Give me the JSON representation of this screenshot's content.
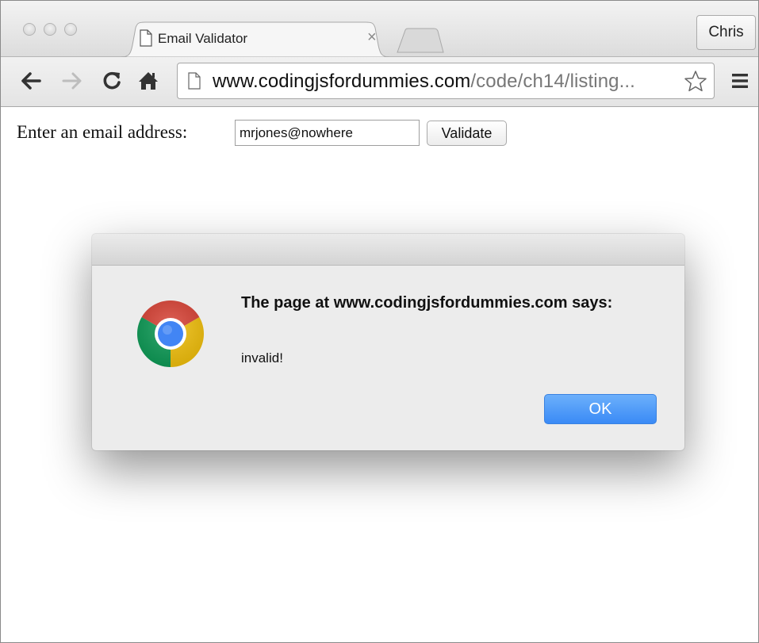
{
  "browser": {
    "tab_title": "Email Validator",
    "tab_close": "×",
    "profile_name": "Chris",
    "url_host": "www.codingjsfordummies.com",
    "url_path": "/code/ch14/listing..."
  },
  "page": {
    "email_label": "Enter an email address:",
    "email_value": "mrjones@nowhere",
    "validate_label": "Validate"
  },
  "dialog": {
    "heading": "The page at www.codingjsfordummies.com says:",
    "message": "invalid!",
    "ok_label": "OK"
  },
  "colors": {
    "ok_button": "#3a8af6",
    "chrome_red": "#db4437",
    "chrome_green": "#0f9d58",
    "chrome_yellow": "#f4c20d",
    "chrome_blue": "#4285f4"
  },
  "icons": [
    "back-arrow-icon",
    "forward-arrow-icon",
    "reload-icon",
    "home-icon",
    "page-icon",
    "star-icon",
    "menu-icon",
    "chrome-logo-icon"
  ]
}
